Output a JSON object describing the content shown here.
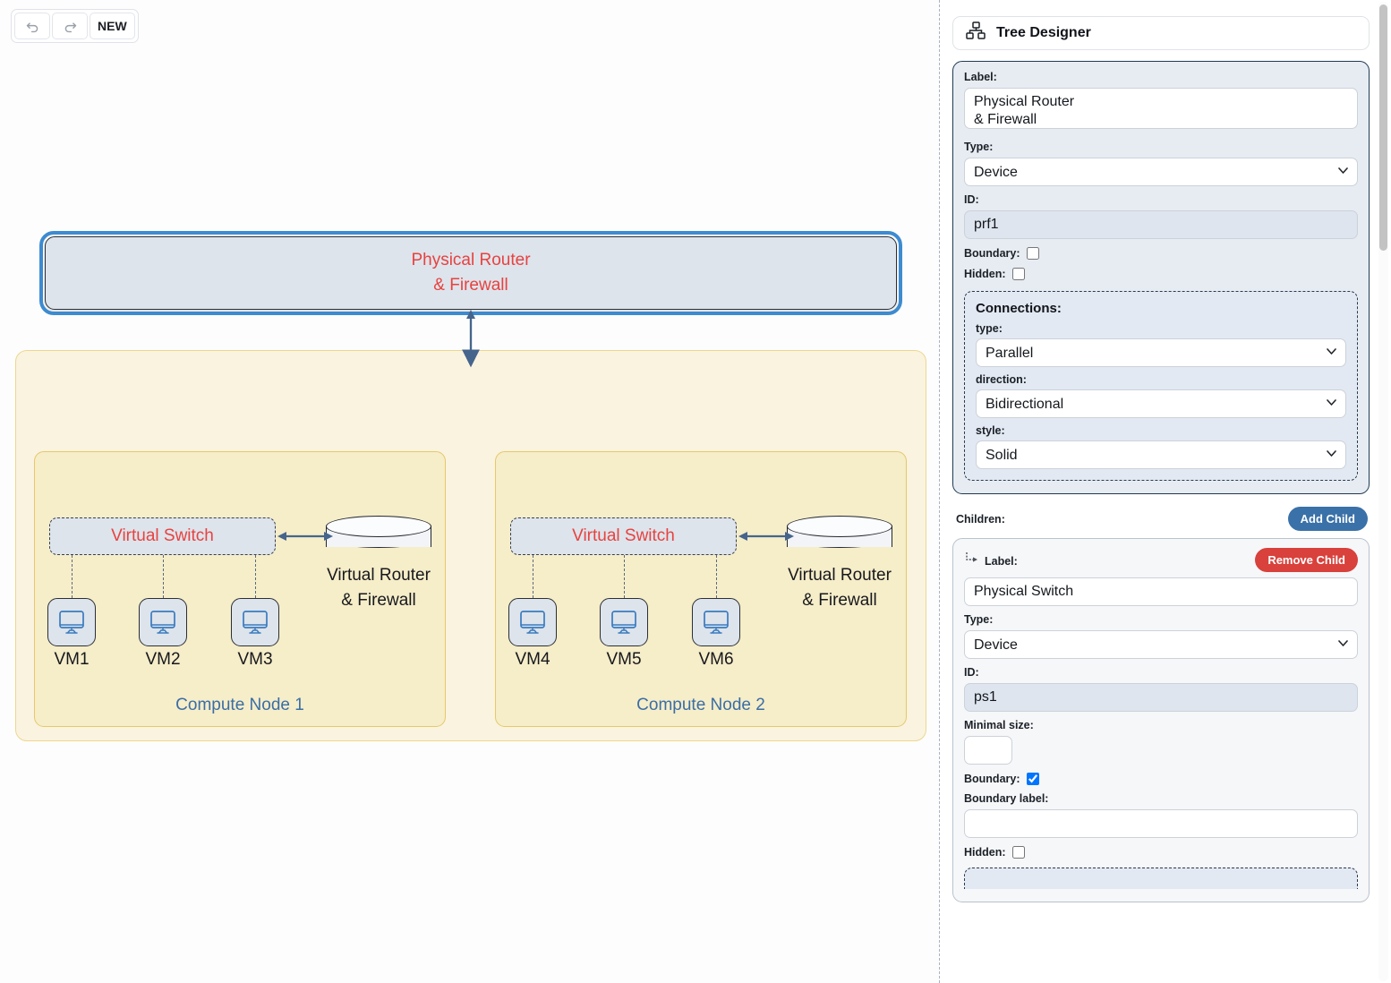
{
  "toolbar": {
    "undo_label": "undo-arrow",
    "redo_label": "redo-arrow",
    "new_label": "NEW"
  },
  "diagram": {
    "physical_router": "Physical Router\n& Firewall",
    "physical_router_line1": "Physical Router",
    "physical_router_line2": "& Firewall",
    "physical_switch": "Physical Switch",
    "compute_nodes": [
      {
        "boundary_label": "Compute Node 1",
        "virtual_switch": "Virtual Switch",
        "virtual_router_line1": "Virtual Router",
        "virtual_router_line2": "& Firewall",
        "vms": [
          "VM1",
          "VM2",
          "VM3"
        ]
      },
      {
        "boundary_label": "Compute Node 2",
        "virtual_switch": "Virtual Switch",
        "virtual_router_line1": "Virtual Router",
        "virtual_router_line2": "& Firewall",
        "vms": [
          "VM4",
          "VM5",
          "VM6"
        ]
      }
    ],
    "colors": {
      "node_fill": "#dde4ec",
      "node_stroke": "#2b2f36",
      "node_text": "#e8423f",
      "boundary_fill": "#faf3e0",
      "boundary_stroke": "#edd78f",
      "compute_fill": "#f6edc9",
      "compute_stroke": "#e5c96a",
      "boundary_label_text": "#3a6ea5",
      "selection_ring": "#3d8bd0",
      "arrow": "#46658c"
    }
  },
  "panel": {
    "title": "Tree Designer",
    "icon": "tree-hierarchy-icon",
    "root": {
      "label_caption": "Label:",
      "label_value": "Physical Router\n& Firewall",
      "type_caption": "Type:",
      "type_value": "Device",
      "id_caption": "ID:",
      "id_value": "prf1",
      "boundary_caption": "Boundary:",
      "boundary_checked": false,
      "hidden_caption": "Hidden:",
      "hidden_checked": false,
      "connections": {
        "title": "Connections:",
        "type_caption": "type:",
        "type_value": "Parallel",
        "direction_caption": "direction:",
        "direction_value": "Bidirectional",
        "style_caption": "style:",
        "style_value": "Solid"
      }
    },
    "children_caption": "Children:",
    "add_child_label": "Add Child",
    "child": {
      "icon": "nested-child-arrow-icon",
      "label_caption": "Label:",
      "label_value": "Physical Switch",
      "remove_label": "Remove Child",
      "type_caption": "Type:",
      "type_value": "Device",
      "id_caption": "ID:",
      "id_value": "ps1",
      "minimal_size_caption": "Minimal size:",
      "minimal_size_value": "",
      "boundary_caption": "Boundary:",
      "boundary_checked": true,
      "boundary_label_caption": "Boundary label:",
      "boundary_label_value": "",
      "hidden_caption": "Hidden:",
      "hidden_checked": false
    },
    "accent_colors": {
      "add_child": "#3a71a8",
      "remove_child": "#d9413c",
      "checkbox_checked": "#2d7ff0"
    }
  }
}
